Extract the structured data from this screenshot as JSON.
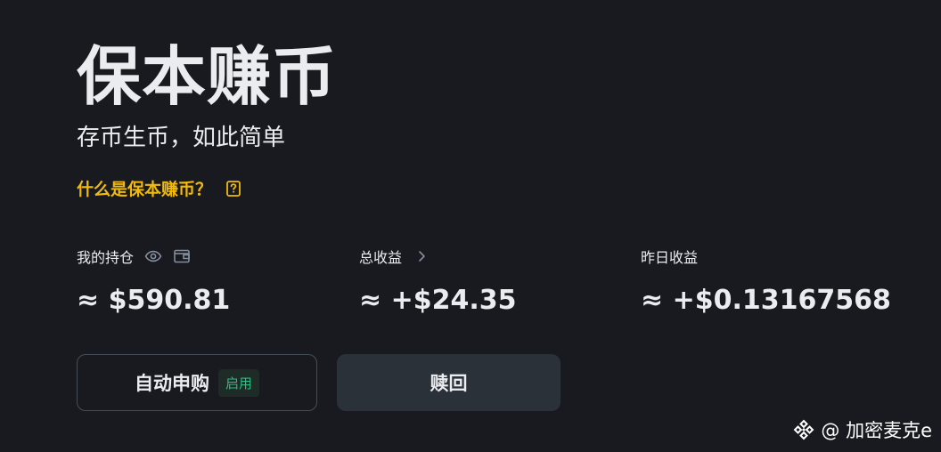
{
  "hero": {
    "title": "保本赚币",
    "subtitle": "存币生币，如此简单",
    "help_link": "什么是保本赚币？"
  },
  "stats": {
    "holdings": {
      "label": "我的持仓",
      "value": "≈ $590.81"
    },
    "total_earnings": {
      "label": "总收益",
      "value": "≈ +$24.35"
    },
    "yesterday_earnings": {
      "label": "昨日收益",
      "value": "≈ +$0.13167568"
    }
  },
  "buttons": {
    "auto_subscribe": {
      "label": "自动申购",
      "badge": "启用"
    },
    "redeem": {
      "label": "赎回"
    }
  },
  "watermark": {
    "text": "@ 加密麦克e"
  },
  "icons": {
    "help": "question-square-icon",
    "eye": "eye-icon",
    "wallet": "wallet-icon",
    "chevron": "chevron-right-icon",
    "logo": "binance-logo-icon"
  },
  "colors": {
    "background": "#181a20",
    "accent": "#f0b90b",
    "success": "#2ebd85",
    "button_secondary": "#2b3139",
    "border": "#474d57"
  }
}
